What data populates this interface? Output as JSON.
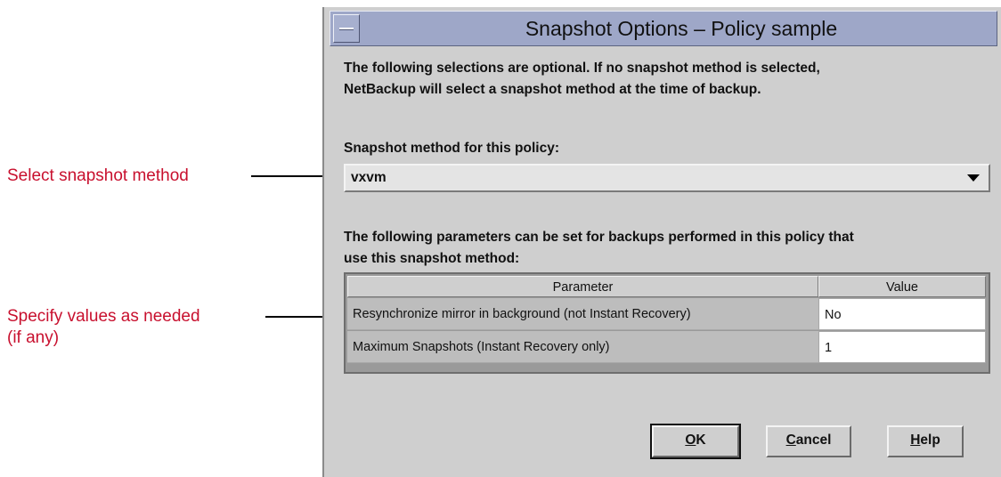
{
  "callouts": {
    "select_method": "Select snapshot method",
    "specify_values_line1": "Specify values as needed",
    "specify_values_line2": "(if any)"
  },
  "dialog": {
    "title": "Snapshot Options – Policy sample",
    "intro_line1": "The following selections are optional. If no snapshot method is selected,",
    "intro_line2": "NetBackup will select a snapshot method at the time of backup.",
    "method_label": "Snapshot method for this policy:",
    "method_value": "vxvm",
    "params_line1": "The following parameters can be set for backups performed in this policy that",
    "params_line2": "use this snapshot method:",
    "table": {
      "headers": [
        "Parameter",
        "Value"
      ],
      "rows": [
        {
          "parameter": "Resynchronize mirror in background (not Instant Recovery)",
          "value": "No"
        },
        {
          "parameter": "Maximum Snapshots (Instant Recovery only)",
          "value": "1"
        }
      ]
    },
    "buttons": {
      "ok": {
        "mnemonic": "O",
        "rest": "K"
      },
      "cancel": {
        "mnemonic": "C",
        "rest": "ancel"
      },
      "help": {
        "mnemonic": "H",
        "rest": "elp"
      }
    }
  },
  "colors": {
    "callout_text": "#c8102e",
    "titlebar": "#9ea7c8",
    "dialog_background": "#cfcfcf"
  }
}
